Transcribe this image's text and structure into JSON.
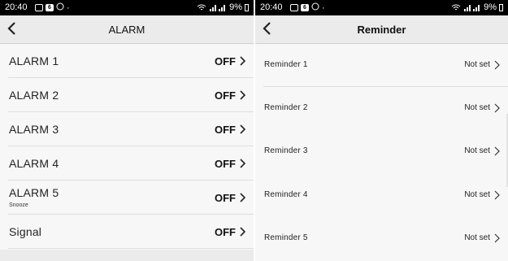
{
  "status": {
    "time": "20:40",
    "app_icons": [
      "image-icon",
      "badge-icon",
      "whatsapp-icon"
    ],
    "dot": "·",
    "right_text": "9%"
  },
  "alarm_screen": {
    "title": "ALARM",
    "items": [
      {
        "label": "ALARM 1",
        "value": "OFF"
      },
      {
        "label": "ALARM 2",
        "value": "OFF"
      },
      {
        "label": "ALARM 3",
        "value": "OFF"
      },
      {
        "label": "ALARM 4",
        "value": "OFF"
      },
      {
        "label": "ALARM 5",
        "sub": "Snooze",
        "value": "OFF"
      },
      {
        "label": "Signal",
        "value": "OFF"
      }
    ]
  },
  "reminder_screen": {
    "title": "Reminder",
    "items": [
      {
        "label": "Reminder 1",
        "value": "Not set"
      },
      {
        "label": "Reminder 2",
        "value": "Not set"
      },
      {
        "label": "Reminder 3",
        "value": "Not set"
      },
      {
        "label": "Reminder 4",
        "value": "Not set"
      },
      {
        "label": "Reminder 5",
        "value": "Not set"
      }
    ]
  },
  "colors": {
    "appbar": "#ebebeb",
    "statusbar": "#000000",
    "background": "#f7f7f7"
  }
}
